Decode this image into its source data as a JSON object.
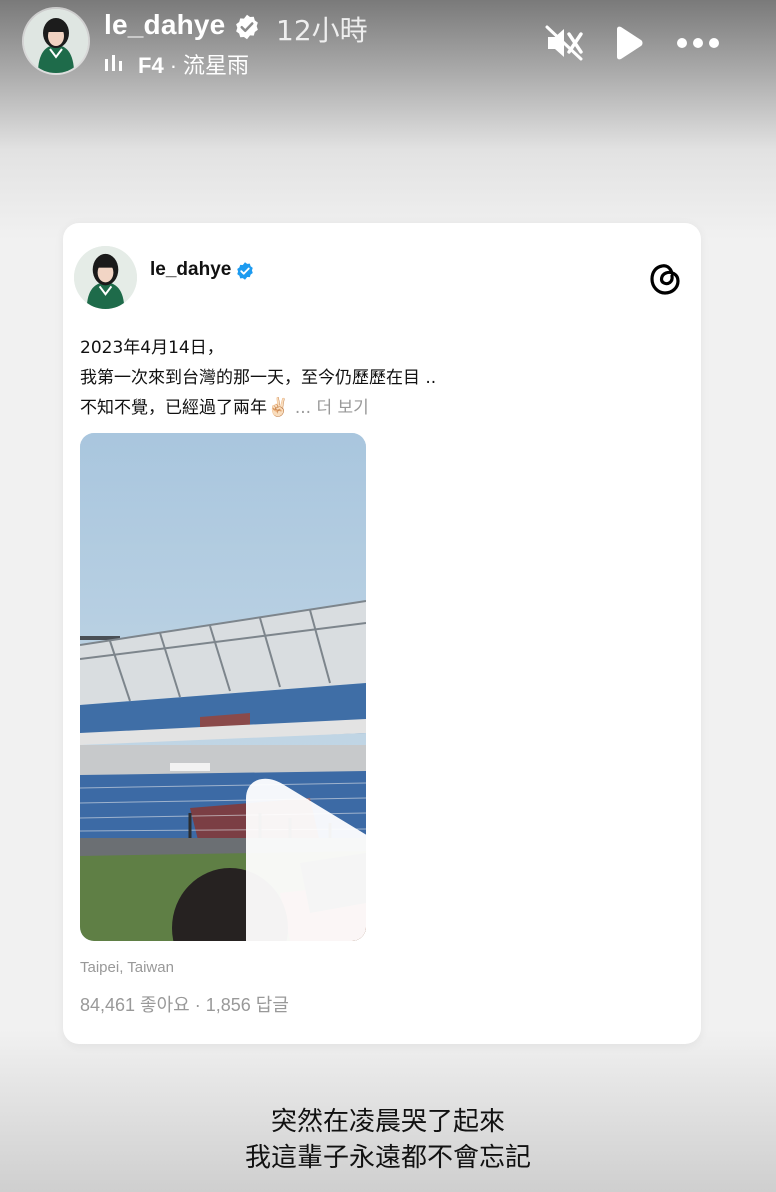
{
  "story": {
    "username": "le_dahye",
    "time": "12小時",
    "music": {
      "artist": "F4",
      "separator": "·",
      "title": "流星雨"
    },
    "icons": {
      "avatar": "profile-avatar",
      "verified": "verified-badge-icon",
      "music": "music-waveform-icon",
      "mute": "muted-speaker-icon",
      "play": "play-icon",
      "more": "more-dots-icon"
    }
  },
  "post": {
    "username": "le_dahye",
    "text_lines": [
      "2023年4月14日，",
      "我第一次來到台灣的那一天，至今仍歷歷在目 ..",
      "不知不覺，已經過了兩年"
    ],
    "emoji": "✌🏻",
    "see_more": "... 더 보기",
    "location": "Taipei, Taiwan",
    "stats": "84,461 좋아요 · 1,856 답글",
    "colors": {
      "verified": "#1d9bf0",
      "muted_text": "#999999"
    },
    "icons": {
      "platform": "threads-logo",
      "media_play": "video-play-icon"
    }
  },
  "caption": {
    "line1": "突然在凌晨哭了起來",
    "line2": "我這輩子永遠都不會忘記"
  }
}
